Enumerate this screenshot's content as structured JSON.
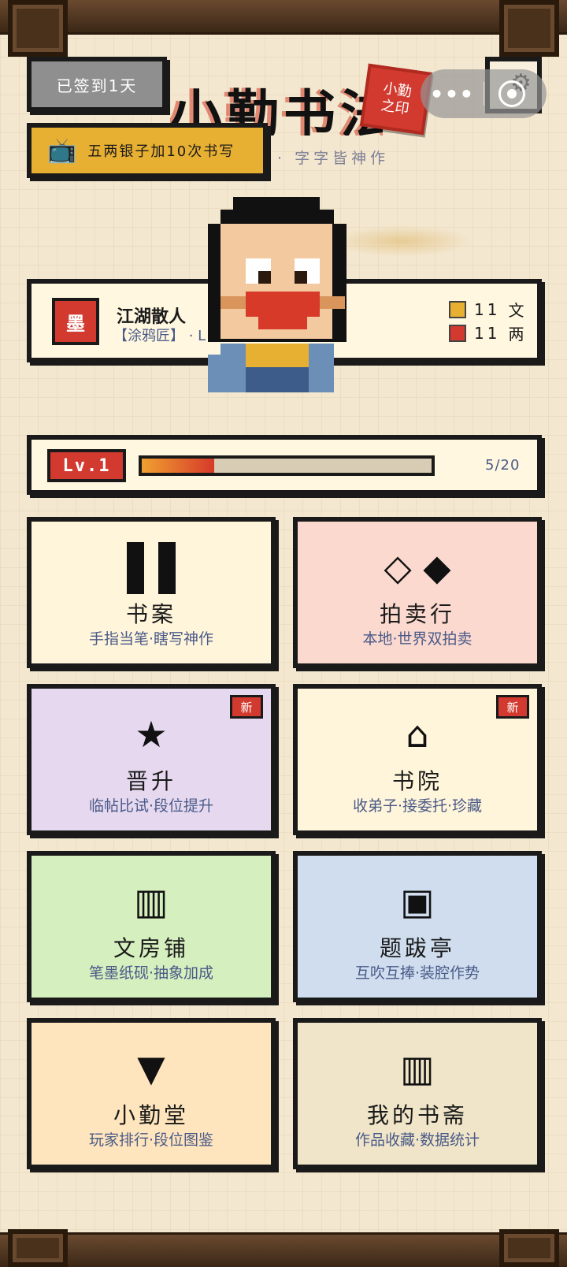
{
  "header": {
    "signin_label": "已签到1天",
    "title": "小勤书法",
    "stamp_line1": "小勤",
    "stamp_line2": "之印",
    "capsule_dots": "•••",
    "reward_icon": "tv-icon",
    "reward_label": "五两银子加10次书写",
    "subtitle": "·  字字皆神作"
  },
  "profile": {
    "badge": "墨",
    "name": "江湖散人",
    "title_line": "【涂鸦匠】 · L",
    "currency": [
      {
        "amount": "11",
        "unit": "文",
        "color": "#e8b032"
      },
      {
        "amount": "11",
        "unit": "两",
        "color": "#d33a2f"
      }
    ]
  },
  "level": {
    "label": "Lv.1",
    "current": 5,
    "max": 20,
    "text": "5/20"
  },
  "tiles": [
    {
      "icon": "pause-icon",
      "title": "书案",
      "subtitle": "手指当笔·瞎写神作",
      "bg": "#fff5da",
      "new": false
    },
    {
      "icon_text": "◇ ◆",
      "title": "拍卖行",
      "subtitle": "本地·世界双拍卖",
      "bg": "#fbd9cf",
      "new": false
    },
    {
      "icon_text": "★",
      "title": "晋升",
      "subtitle": "临帖比试·段位提升",
      "bg": "#e5d8ef",
      "new": true,
      "badge": "新"
    },
    {
      "icon_text": "⌂",
      "title": "书院",
      "subtitle": "收弟子·接委托·珍藏",
      "bg": "#fff5da",
      "new": true,
      "badge": "新"
    },
    {
      "icon_text": "▥",
      "title": "文房铺",
      "subtitle": "笔墨纸砚·抽象加成",
      "bg": "#d6efbf",
      "new": false
    },
    {
      "icon_text": "▣",
      "title": "题跋亭",
      "subtitle": "互吹互捧·装腔作势",
      "bg": "#cfddee",
      "new": false
    },
    {
      "icon_text": "▼",
      "title": "小勤堂",
      "subtitle": "玩家排行·段位图鉴",
      "bg": "#ffe5bd",
      "new": false
    },
    {
      "icon_text": "▥",
      "title": "我的书斋",
      "subtitle": "作品收藏·数据统计",
      "bg": "#f0e5c8",
      "new": false
    }
  ]
}
